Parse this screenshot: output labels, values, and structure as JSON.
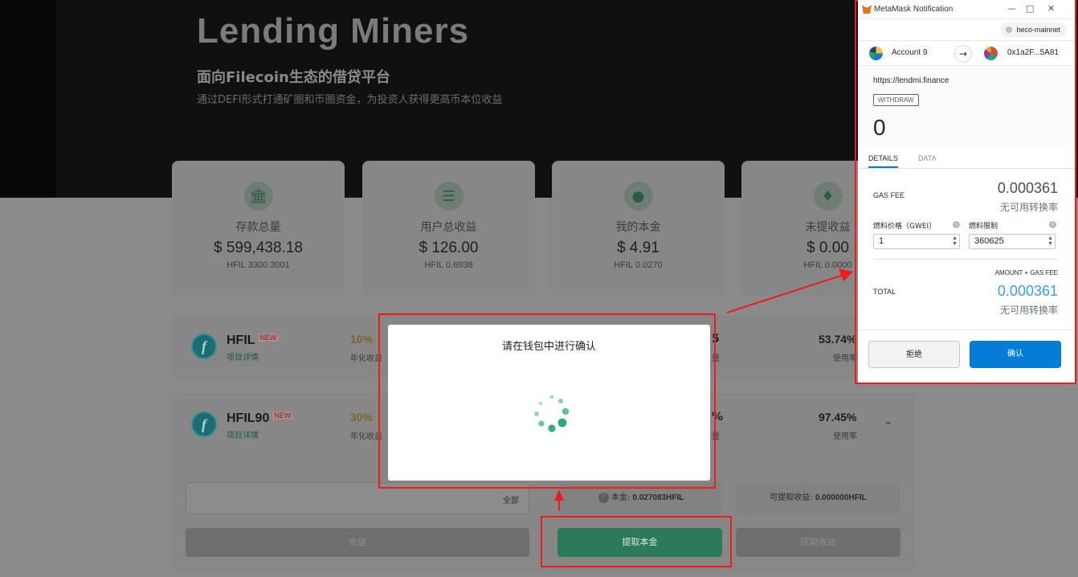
{
  "page": {
    "brand": "Lending Miners",
    "subtitle": "面向Filecoin生态的借贷平台",
    "description": "通过DEFI形式打通矿圈和币圈资金，为投资人获得更高币本位收益"
  },
  "stats": [
    {
      "label": "存款总量",
      "value": "$ 599,438.18",
      "sub": "HFIL 3300.3001",
      "icon": "bank-icon"
    },
    {
      "label": "用户总收益",
      "value": "$ 126.00",
      "sub": "HFIL 0.6938",
      "icon": "coins-icon"
    },
    {
      "label": "我的本金",
      "value": "$ 4.91",
      "sub": "HFIL 0.0270",
      "icon": "coin-stack-icon"
    },
    {
      "label": "未提收益",
      "value": "$ 0.00",
      "sub": "HFIL 0.0000",
      "icon": "wallet-icon"
    }
  ],
  "pools": [
    {
      "name": "HFIL",
      "badge": "NEW",
      "link": "项目详情",
      "apy": "10%",
      "apy_label": "年化收益",
      "util": "53.74%",
      "util_label": "使用率",
      "frag_num": "5",
      "frag_label": "量"
    },
    {
      "name": "HFIL90",
      "badge": "NEW",
      "link": "项目详情",
      "apy": "30%",
      "apy_label": "年化收益",
      "util": "97.45%",
      "util_label": "使用率",
      "frag_num": "%",
      "frag_label": "量"
    }
  ],
  "action": {
    "all_label": "全部",
    "principal_label": "本金:",
    "principal_value": "0.027083HFIL",
    "withdrawable_label": "可提取收益:",
    "withdrawable_value": "0.000000HFIL",
    "deposit_button": "充值",
    "withdraw_principal_button": "提取本金",
    "withdraw_income_button": "提取收益"
  },
  "modal": {
    "title": "请在钱包中进行确认"
  },
  "metamask": {
    "window_title": "MetaMask Notification",
    "network": "heco-mainnet",
    "account_name": "Account 9",
    "destination": "0x1a2F...5A81",
    "origin": "https://lendmi.finance",
    "method": "WITHDRAW",
    "amount": "0",
    "tabs": [
      "DETAILS",
      "DATA"
    ],
    "gas_fee_label": "GAS FEE",
    "gas_fee_value": "0.000361",
    "gas_fee_sub": "无可用转换率",
    "gas_price_label": "燃料价格（GWEI）",
    "gas_price_value": "1",
    "gas_limit_label": "燃料限制",
    "gas_limit_value": "360625",
    "amount_plus_gas_label": "AMOUNT + GAS FEE",
    "total_label": "TOTAL",
    "total_value": "0.000361",
    "total_sub": "无可用转换率",
    "reject_button": "拒绝",
    "confirm_button": "确认"
  },
  "colors": {
    "accent_green": "#2b7a58",
    "metamask_blue": "#037dd6",
    "annotation_red": "#ee1d1d"
  }
}
